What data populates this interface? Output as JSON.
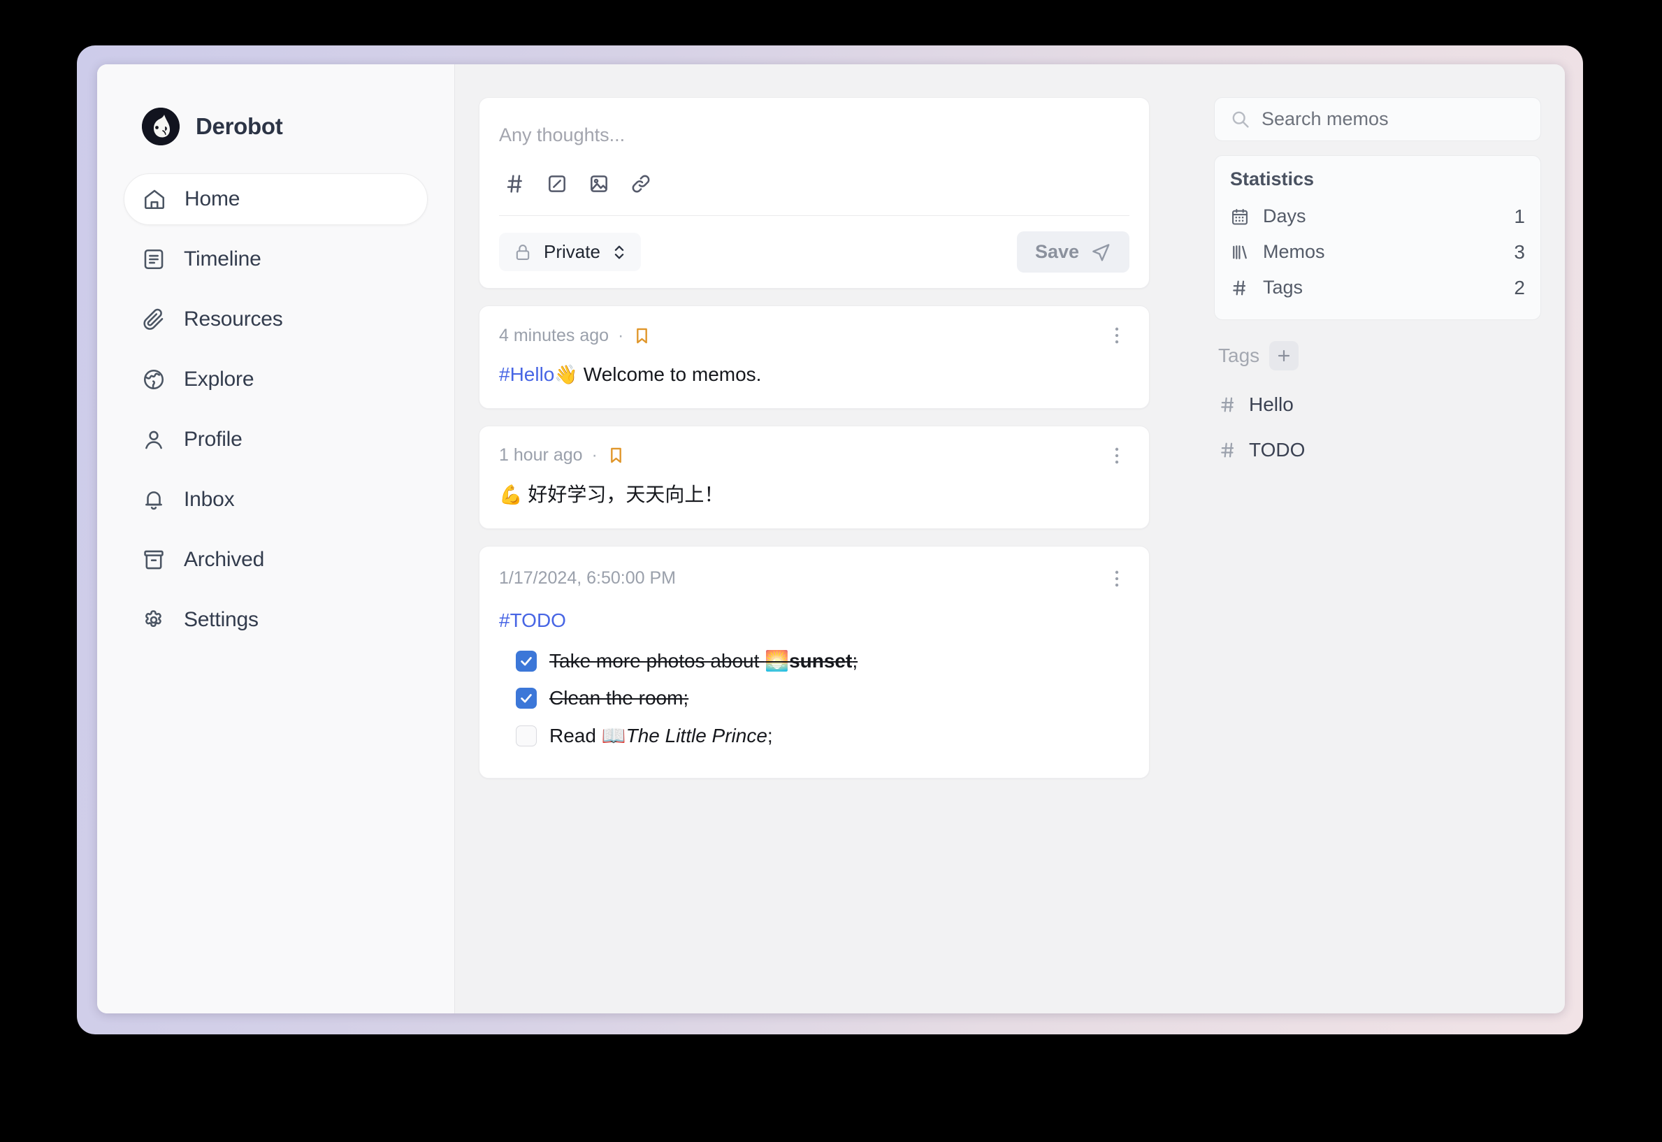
{
  "app": {
    "brand_name": "Derobot",
    "avatar_icon": "bird-avatar-icon"
  },
  "sidebar": {
    "items": [
      {
        "label": "Home",
        "icon": "home-icon",
        "active": true
      },
      {
        "label": "Timeline",
        "icon": "timeline-icon",
        "active": false
      },
      {
        "label": "Resources",
        "icon": "paperclip-icon",
        "active": false
      },
      {
        "label": "Explore",
        "icon": "globe-icon",
        "active": false
      },
      {
        "label": "Profile",
        "icon": "user-icon",
        "active": false
      },
      {
        "label": "Inbox",
        "icon": "bell-icon",
        "active": false
      },
      {
        "label": "Archived",
        "icon": "archive-icon",
        "active": false
      },
      {
        "label": "Settings",
        "icon": "gear-icon",
        "active": false
      }
    ]
  },
  "editor": {
    "placeholder": "Any thoughts...",
    "tools": [
      {
        "name": "hash-icon",
        "title": "Add tag"
      },
      {
        "name": "checkbox-icon",
        "title": "Add checkbox"
      },
      {
        "name": "image-icon",
        "title": "Add image"
      },
      {
        "name": "link-icon",
        "title": "Add link"
      }
    ],
    "visibility_label": "Private",
    "visibility_icon": "lock-icon",
    "save_label": "Save",
    "save_icon": "send-icon",
    "save_disabled": true
  },
  "memos": [
    {
      "time": "4 minutes ago",
      "separator": "·",
      "bookmarked": true,
      "type": "text",
      "tag": "#Hello",
      "emoji": "👋",
      "text": " Welcome to memos."
    },
    {
      "time": "1 hour ago",
      "separator": "·",
      "bookmarked": true,
      "type": "text",
      "tag": "",
      "emoji": "💪",
      "text": " 好好学习，天天向上！"
    },
    {
      "time": "1/17/2024, 6:50:00 PM",
      "separator": "",
      "bookmarked": false,
      "type": "todo",
      "tag": "#TODO",
      "items": [
        {
          "checked": true,
          "pre": "Take more photos about ",
          "emoji": "🌅",
          "bold": "sunset",
          "post": ";",
          "italic": ""
        },
        {
          "checked": true,
          "pre": "Clean the room;",
          "emoji": "",
          "bold": "",
          "post": "",
          "italic": ""
        },
        {
          "checked": false,
          "pre": "Read ",
          "emoji": "📖",
          "bold": "",
          "post": ";",
          "italic": "The Little Prince"
        }
      ]
    }
  ],
  "search": {
    "placeholder": "Search memos",
    "value": "",
    "icon": "search-icon"
  },
  "statistics": {
    "title": "Statistics",
    "rows": [
      {
        "label": "Days",
        "value": "1",
        "icon": "calendar-icon"
      },
      {
        "label": "Memos",
        "value": "3",
        "icon": "library-icon"
      },
      {
        "label": "Tags",
        "value": "2",
        "icon": "hash-icon"
      }
    ]
  },
  "tags": {
    "title": "Tags",
    "add_icon": "plus-icon",
    "items": [
      {
        "label": "Hello",
        "icon": "hash-icon"
      },
      {
        "label": "TODO",
        "icon": "hash-icon"
      }
    ]
  },
  "colors": {
    "accent_blue": "#4765e4",
    "checkbox_blue": "#3c77d8",
    "bookmark_amber": "#e0962a",
    "frame_left": "#cdccea",
    "frame_right": "#f1e3e6"
  }
}
